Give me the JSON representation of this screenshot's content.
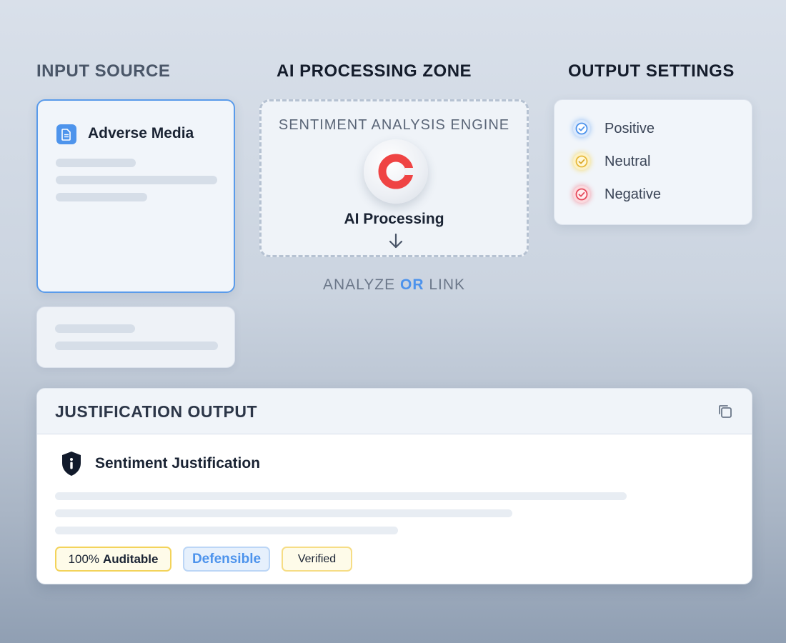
{
  "columns": {
    "input_title": "INPUT SOURCE",
    "ai_title": "AI PROCESSING ZONE",
    "output_title": "OUTPUT SETTINGS"
  },
  "input": {
    "source_label": "Adverse Media",
    "icon": "document-icon"
  },
  "ai_zone": {
    "engine_label": "SENTIMENT ANALYSIS ENGINE",
    "processing_label": "AI Processing",
    "action_left": "ANALYZE",
    "action_or": "OR",
    "action_right": "LINK"
  },
  "output_settings": {
    "options": [
      {
        "label": "Positive",
        "color": "#4d93ec"
      },
      {
        "label": "Neutral",
        "color": "#f2c94c"
      },
      {
        "label": "Negative",
        "color": "#ef5a6a"
      }
    ]
  },
  "justification": {
    "title": "JUSTIFICATION OUTPUT",
    "subtitle": "Sentiment Justification",
    "tags": {
      "auditable_prefix": "100%",
      "auditable_word": "Auditable",
      "defensible": "Defensible",
      "verified": "Verified"
    }
  },
  "colors": {
    "accent": "#4d93ec",
    "engine_red": "#ef4444"
  }
}
